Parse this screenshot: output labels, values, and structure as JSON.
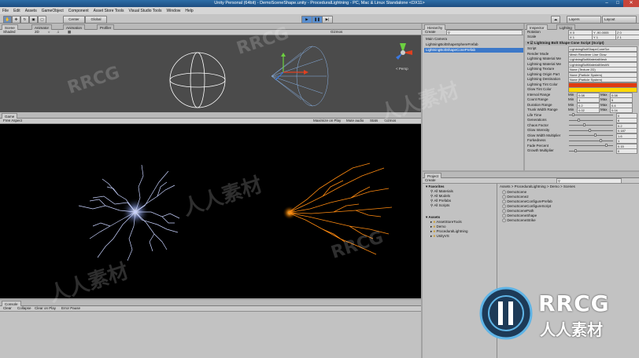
{
  "window": {
    "title": "Unity Personal (64bit) - DemoSceneShape.unity - ProceduralLightning - PC, Mac & Linux Standalone <DX11>"
  },
  "menu": [
    "File",
    "Edit",
    "Assets",
    "GameObject",
    "Component",
    "Asset Store Tools",
    "Visual Studio Tools",
    "Window",
    "Help"
  ],
  "toolbar": {
    "center": "Center",
    "global": "Global",
    "layers": "Layers",
    "layout": "Layout"
  },
  "scene": {
    "tab": "Scene",
    "anim_tab": "Animator",
    "anim2_tab": "Animation",
    "profiler_tab": "Profiler",
    "shaded": "Shaded",
    "mode2d": "2D",
    "gizmos": "Gizmos",
    "persp": "< Persp"
  },
  "game": {
    "tab": "Game",
    "aspect": "Free Aspect",
    "maximize": "Maximize on Play",
    "mute": "Mute audio",
    "stats": "Stats",
    "gizmos": "Gizmos"
  },
  "console": {
    "tab": "Console",
    "clear": "Clear",
    "collapse": "Collapse",
    "clear_on_play": "Clear on Play",
    "error_pause": "Error Pause"
  },
  "hierarchy": {
    "tab": "Hierarchy",
    "create": "Create",
    "items": [
      "Main Camera",
      "LightningBoltShapeSphereFrefab",
      "LightningBoltShapeConePrefab"
    ]
  },
  "project": {
    "tab": "Project",
    "create": "Create",
    "favorites": "Favorites",
    "fav_items": [
      "All Materials",
      "All Models",
      "All Prefabs",
      "All Scripts"
    ],
    "assets": "Assets",
    "asset_items": [
      "AssetStoreTools",
      "Demo",
      "ProceduralLightning",
      "UnityVS"
    ],
    "breadcrumb": "Assets > ProceduralLightning > Demo > Scenes",
    "files": [
      "DemoScene",
      "DemoScene2",
      "DemoSceneConfigurePrefab",
      "DemoSceneConfigureScript",
      "DemoScenePath",
      "DemoSceneShape",
      "DemoSceneStrike"
    ]
  },
  "inspector": {
    "tab": "Inspector",
    "lighting_tab": "Lighting",
    "transform_rows": [
      {
        "label": "Rotation",
        "x": "X  0",
        "y": "Y  -90.0005",
        "z": "Z  0"
      },
      {
        "label": "Scale",
        "x": "X  1",
        "y": "Y  1",
        "z": "Z  1"
      }
    ],
    "component": "Lightning Bolt Shape Cone Script (Script)",
    "props": [
      {
        "label": "Script",
        "value": "LightningBoltShapeConeScr"
      },
      {
        "label": "Render Mode",
        "value": "Mesh Renderer Line Glow"
      },
      {
        "label": "Lightning Material Me",
        "value": "LightningBoltMaterialMesh"
      },
      {
        "label": "Lightning Material Me",
        "value": "LightningBoltMaterialMeshN"
      },
      {
        "label": "Lightning Texture",
        "value": "None (Texture 2D)"
      },
      {
        "label": "Lightning Origin Part",
        "value": "None (Particle System)"
      },
      {
        "label": "Lightning Destination",
        "value": "None (Particle System)"
      },
      {
        "label": "Lightning Tint Color",
        "value": ""
      },
      {
        "label": "Glow Tint Color",
        "value": ""
      }
    ],
    "ranges": [
      {
        "label": "Interval Range",
        "min": "0.08",
        "max": "0.08"
      },
      {
        "label": "Count Range",
        "min": "1",
        "max": "5"
      },
      {
        "label": "Duration Range",
        "min": "0.2",
        "max": "0.4"
      },
      {
        "label": "Trunk Width Range",
        "min": "0.02",
        "max": "0.04"
      }
    ],
    "min_label": "Min",
    "max_label": "Max",
    "sliders": [
      {
        "label": "Life Time",
        "value": "0"
      },
      {
        "label": "Generations",
        "value": "6"
      },
      {
        "label": "Chaos Factor",
        "value": "0.2"
      },
      {
        "label": "Glow Intensity",
        "value": "0.187"
      },
      {
        "label": "Glow Width Multiplier",
        "value": "1.6"
      },
      {
        "label": "Forkedness",
        "value": "1"
      },
      {
        "label": "Fade Percent",
        "value": "0.15"
      },
      {
        "label": "Growth Multiplier",
        "value": "0"
      }
    ],
    "colors": {
      "tint": "#e03a10",
      "glow": "#ffd800"
    }
  },
  "watermark": {
    "small": "RRCG",
    "cn": "人人素材",
    "logo_text": "RRCG",
    "logo_cn": "人人素材"
  }
}
